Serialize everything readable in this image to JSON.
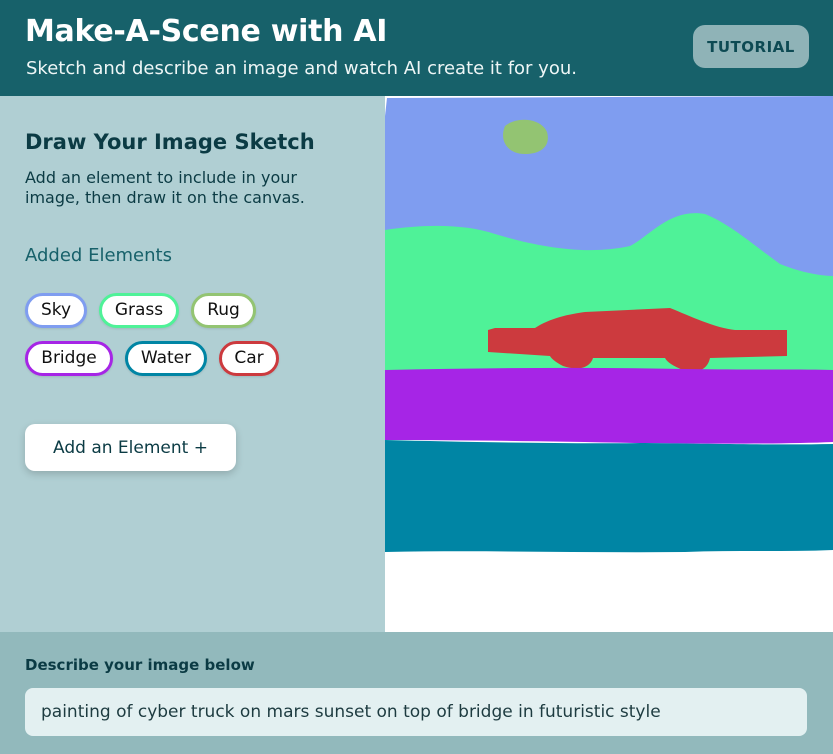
{
  "header": {
    "title": "Make-A-Scene with AI",
    "subtitle": "Sketch and describe an image and watch AI create it for you.",
    "tutorial_label": "TUTORIAL"
  },
  "sidebar": {
    "title": "Draw Your Image Sketch",
    "description": "Add an element to include in your image, then draw it on the canvas.",
    "elements_heading": "Added Elements",
    "elements": [
      {
        "label": "Sky",
        "color": "#7f9df0"
      },
      {
        "label": "Grass",
        "color": "#4ff298"
      },
      {
        "label": "Rug",
        "color": "#93c472"
      },
      {
        "label": "Bridge",
        "color": "#a625e6"
      },
      {
        "label": "Water",
        "color": "#0085a4"
      },
      {
        "label": "Car",
        "color": "#cc3a3e"
      }
    ],
    "add_element_label": "Add an Element +"
  },
  "canvas": {
    "colors": {
      "sky": "#7f9df0",
      "sun": "#93c472",
      "grass": "#4ff298",
      "car": "#cc3a3e",
      "bridge": "#a625e6",
      "water": "#0085a4",
      "background": "#ffffff"
    }
  },
  "footer": {
    "describe_label": "Describe your image below",
    "prompt_value": "painting of cyber truck on mars sunset on top of bridge in futuristic style"
  }
}
